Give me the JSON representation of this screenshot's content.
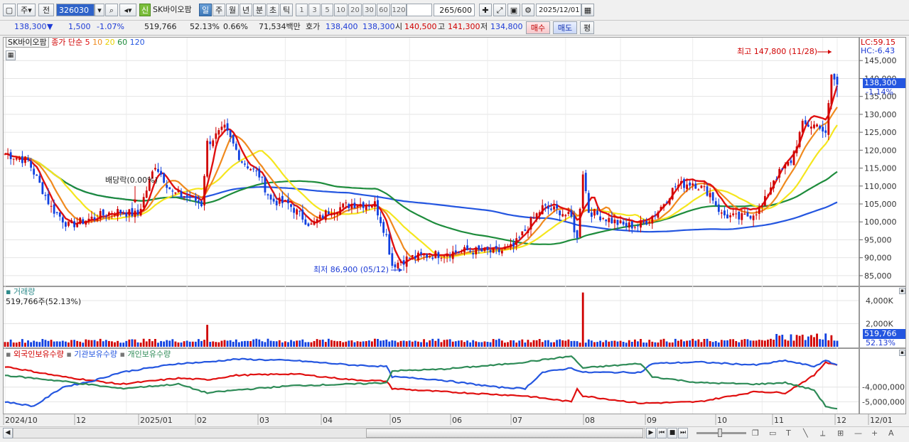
{
  "toolbar": {
    "period_label": "주",
    "prev_label": "전",
    "code": "326030",
    "stock_name": "SK바이오팜",
    "new_badge": "신",
    "periods": [
      "일",
      "주",
      "월",
      "년",
      "분",
      "초",
      "틱"
    ],
    "active_period": "일",
    "minute_options": [
      "1",
      "3",
      "5",
      "10",
      "20",
      "30",
      "60",
      "120"
    ],
    "count_value": "265",
    "count_total": "/600",
    "date": "2025/12/01"
  },
  "quote": {
    "price": "138,300",
    "change_arrow": "▼",
    "change": "1,500",
    "change_pct": "-1.07%",
    "volume": "519,766",
    "volume_ratio": "52.13%",
    "turnover_pct": "0.66%",
    "amount": "71,534백만",
    "hoga_label": "호가",
    "ask": "138,400",
    "bid": "138,300",
    "open_label": "시",
    "open": "140,500",
    "high_label": "고",
    "high": "141,300",
    "low_label": "저",
    "low": "134,800",
    "buy_label": "매수",
    "sell_label": "매도",
    "avg_label": "평"
  },
  "colors": {
    "candle_up": "#d00000",
    "candle_down": "#1040e0",
    "ma5": "#e01010",
    "ma10": "#f08a1e",
    "ma20": "#f5e61e",
    "ma60": "#1e8c3c",
    "ma120": "#2456e0",
    "foreign": "#e01010",
    "institution": "#2456e0",
    "individual": "#2e8b57"
  },
  "chart_data": [
    {
      "type": "candlestick",
      "legend_name": "SK바이오팜",
      "legend_series": "종가 단순",
      "ma_periods": [
        "5",
        "10",
        "20",
        "60",
        "120"
      ],
      "ylim": [
        83000,
        150000
      ],
      "yticks": [
        "145,000",
        "140,000",
        "135,000",
        "130,000",
        "125,000",
        "120,000",
        "115,000",
        "110,000",
        "105,000",
        "100,000",
        "95,000",
        "90,000",
        "85,000"
      ],
      "lc_label": "LC:59.15",
      "hc_label": "HC:-6.43",
      "current_price_label": "138,300",
      "current_change_label": "-1.14%",
      "high_annotation": "최고 147,800 (11/28)",
      "low_annotation": "최저 86,900 (05/12)",
      "event_annotation": "배당락(0.00%)",
      "x_labels": [
        "2024/10",
        "12",
        "2025/01",
        "02",
        "03",
        "04",
        "05",
        "06",
        "07",
        "08",
        "09",
        "10",
        "11",
        "12",
        "12/01"
      ],
      "close_anchors": [
        [
          0,
          119000
        ],
        [
          8,
          117000
        ],
        [
          16,
          104000
        ],
        [
          22,
          99000
        ],
        [
          30,
          101000
        ],
        [
          38,
          103000
        ],
        [
          46,
          102000
        ],
        [
          52,
          116000
        ],
        [
          58,
          108000
        ],
        [
          64,
          107000
        ],
        [
          68,
          105000
        ],
        [
          70,
          122000
        ],
        [
          76,
          126000
        ],
        [
          82,
          117000
        ],
        [
          88,
          113000
        ],
        [
          92,
          106000
        ],
        [
          98,
          105000
        ],
        [
          106,
          99000
        ],
        [
          112,
          103000
        ],
        [
          120,
          105000
        ],
        [
          128,
          105000
        ],
        [
          132,
          96000
        ],
        [
          134,
          88000
        ],
        [
          140,
          90000
        ],
        [
          150,
          91000
        ],
        [
          160,
          92000
        ],
        [
          170,
          91500
        ],
        [
          176,
          93000
        ],
        [
          182,
          100000
        ],
        [
          186,
          104000
        ],
        [
          192,
          103000
        ],
        [
          196,
          101000
        ],
        [
          198,
          95000
        ],
        [
          200,
          114000
        ],
        [
          202,
          103000
        ],
        [
          208,
          101000
        ],
        [
          214,
          99000
        ],
        [
          220,
          99000
        ],
        [
          226,
          103000
        ],
        [
          232,
          110000
        ],
        [
          238,
          111000
        ],
        [
          244,
          108000
        ],
        [
          248,
          102000
        ],
        [
          254,
          101000
        ],
        [
          258,
          102000
        ],
        [
          262,
          104000
        ],
        [
          266,
          112000
        ],
        [
          272,
          117000
        ],
        [
          276,
          127000
        ],
        [
          282,
          127000
        ],
        [
          284,
          124000
        ],
        [
          286,
          141000
        ],
        [
          288,
          138300
        ]
      ],
      "ma_values_end": {
        "ma5": 138000,
        "ma10": 132000,
        "ma20": 127000,
        "ma60": 114000,
        "ma120": 105500
      }
    },
    {
      "type": "bar",
      "title": "거래량",
      "volume_label": "519,766주(52.13%)",
      "yticks": [
        "4,000K",
        "2,000K"
      ],
      "ylim": [
        0,
        4800000
      ],
      "current_label": "519,766",
      "current_pct": "52.13%"
    },
    {
      "type": "line",
      "series": [
        {
          "name": "외국인보유수량",
          "anchors": [
            [
              0,
              -2600000
            ],
            [
              20,
              -3300000
            ],
            [
              40,
              -3800000
            ],
            [
              60,
              -3400000
            ],
            [
              70,
              -3500000
            ],
            [
              80,
              -3200000
            ],
            [
              100,
              -3100000
            ],
            [
              120,
              -3500000
            ],
            [
              132,
              -3600000
            ],
            [
              134,
              -4100000
            ],
            [
              150,
              -4300000
            ],
            [
              170,
              -4500000
            ],
            [
              180,
              -4600000
            ],
            [
              196,
              -5000000
            ],
            [
              198,
              -4100000
            ],
            [
              200,
              -4600000
            ],
            [
              220,
              -5100000
            ],
            [
              240,
              -5000000
            ],
            [
              260,
              -4300000
            ],
            [
              270,
              -4400000
            ],
            [
              280,
              -3200000
            ],
            [
              284,
              -2300000
            ],
            [
              288,
              -2500000
            ]
          ]
        },
        {
          "name": "기관보유수량",
          "anchors": [
            [
              0,
              -5000000
            ],
            [
              10,
              -5300000
            ],
            [
              20,
              -4000000
            ],
            [
              30,
              -3600000
            ],
            [
              40,
              -3000000
            ],
            [
              60,
              -2400000
            ],
            [
              70,
              -2300000
            ],
            [
              80,
              -2100000
            ],
            [
              100,
              -2200000
            ],
            [
              120,
              -2500000
            ],
            [
              132,
              -2600000
            ],
            [
              134,
              -3300000
            ],
            [
              150,
              -3500000
            ],
            [
              170,
              -4000000
            ],
            [
              180,
              -4100000
            ],
            [
              186,
              -3000000
            ],
            [
              196,
              -2700000
            ],
            [
              200,
              -3000000
            ],
            [
              220,
              -3000000
            ],
            [
              224,
              -2400000
            ],
            [
              240,
              -2300000
            ],
            [
              260,
              -2500000
            ],
            [
              270,
              -2200000
            ],
            [
              280,
              -2600000
            ],
            [
              284,
              -2200000
            ],
            [
              288,
              -2500000
            ]
          ]
        },
        {
          "name": "개인보유수량",
          "anchors": [
            [
              0,
              -3200000
            ],
            [
              20,
              -3600000
            ],
            [
              40,
              -4100000
            ],
            [
              60,
              -3800000
            ],
            [
              70,
              -4400000
            ],
            [
              80,
              -4200000
            ],
            [
              100,
              -3900000
            ],
            [
              120,
              -3800000
            ],
            [
              132,
              -3700000
            ],
            [
              134,
              -2900000
            ],
            [
              150,
              -2800000
            ],
            [
              170,
              -2500000
            ],
            [
              180,
              -2300000
            ],
            [
              196,
              -1900000
            ],
            [
              200,
              -2700000
            ],
            [
              220,
              -2400000
            ],
            [
              224,
              -3300000
            ],
            [
              240,
              -3700000
            ],
            [
              260,
              -3800000
            ],
            [
              270,
              -3700000
            ],
            [
              280,
              -4200000
            ],
            [
              284,
              -5300000
            ],
            [
              288,
              -5500000
            ]
          ]
        }
      ],
      "yticks": [
        "-4,000,000",
        "-5,000,000"
      ],
      "ylim": [
        -5800000,
        -1600000
      ]
    }
  ]
}
